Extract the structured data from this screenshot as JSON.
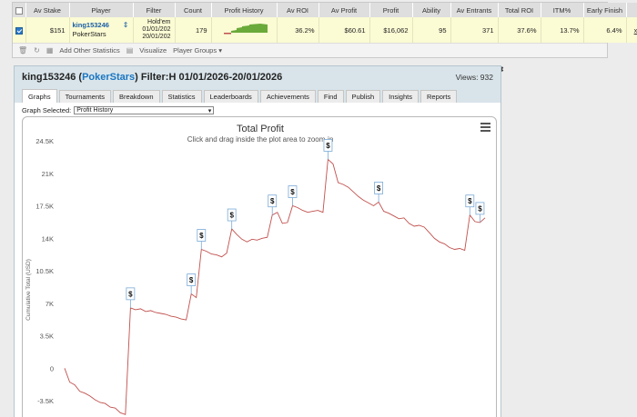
{
  "stats_table": {
    "headers": [
      "Av Stake",
      "Player",
      "Filter",
      "Count",
      "Profit History",
      "Av ROI",
      "Av Profit",
      "Profit",
      "Ability",
      "Av Entrants",
      "Total ROI",
      "ITM%",
      "Early Finish"
    ],
    "row": {
      "checked": true,
      "av_stake": "$151",
      "player_name": "king153246",
      "player_site": "PokerStars",
      "filter_lines": [
        "Hold'em",
        "01/01/202",
        "20/01/202"
      ],
      "count": "179",
      "av_roi": "36.2%",
      "av_profit": "$60.61",
      "profit": "$16,062",
      "ability": "95",
      "av_entrants": "371",
      "total_roi": "37.6%",
      "itm": "13.7%",
      "early_finish": "6.4%",
      "remove": "x"
    },
    "toolbar": {
      "add_stats": "Add Other Statistics",
      "visualize": "Visualize",
      "player_groups": "Player Groups"
    }
  },
  "panel": {
    "player": "king153246",
    "site": "PokerStars",
    "filter_text": "Filter:H 01/01/2026-20/01/2026",
    "views": "Views: 932",
    "tabs": [
      "Graphs",
      "Tournaments",
      "Breakdown",
      "Statistics",
      "Leaderboards",
      "Achievements",
      "Find",
      "Publish",
      "Insights",
      "Reports"
    ],
    "active_tab": "Graphs",
    "graph_selected_label": "Graph Selected:",
    "graph_selected_value": "Profit History"
  },
  "chart_data": {
    "type": "line",
    "title": "Total Profit",
    "subtitle": "Click and drag inside the plot area to zoom-in",
    "ylabel": "Cumulative Total (USD)",
    "ylim": [
      -5000,
      24500
    ],
    "yticks": [
      "24.5K",
      "21K",
      "17.5K",
      "14K",
      "10.5K",
      "7K",
      "3.5K",
      "0",
      "-3.5K"
    ],
    "ytick_values": [
      24500,
      21000,
      17500,
      14000,
      10500,
      7000,
      3500,
      0,
      -3500
    ],
    "series": [
      {
        "color": "#c0504d",
        "values": [
          0,
          -1500,
          -1800,
          -2500,
          -2700,
          -3000,
          -3400,
          -3700,
          -3800,
          -4200,
          -4300,
          -4800,
          -5000,
          6500,
          6300,
          6400,
          6100,
          6200,
          6000,
          5900,
          5800,
          5600,
          5500,
          5300,
          5200,
          8000,
          7600,
          12800,
          12600,
          12300,
          12200,
          12000,
          12400,
          15000,
          14400,
          13900,
          13600,
          13900,
          13800,
          14000,
          14100,
          16500,
          16800,
          15600,
          15700,
          17500,
          17300,
          17000,
          16800,
          16900,
          17000,
          16800,
          22500,
          22000,
          20000,
          19800,
          19500,
          19000,
          18500,
          18100,
          17800,
          17500,
          17900,
          16900,
          16700,
          16400,
          16100,
          16200,
          15600,
          15300,
          15400,
          15200,
          14600,
          14000,
          13600,
          13400,
          13000,
          12800,
          12900,
          12700,
          16500,
          15800,
          15700,
          16200
        ]
      }
    ],
    "markers": [
      {
        "label": "$",
        "index": 13
      },
      {
        "label": "$",
        "index": 25
      },
      {
        "label": "$",
        "index": 27
      },
      {
        "label": "$",
        "index": 33
      },
      {
        "label": "$",
        "index": 41
      },
      {
        "label": "$",
        "index": 45
      },
      {
        "label": "$",
        "index": 52
      },
      {
        "label": "$",
        "index": 62
      },
      {
        "label": "$",
        "index": 80
      },
      {
        "label": "$",
        "index": 82
      }
    ]
  }
}
